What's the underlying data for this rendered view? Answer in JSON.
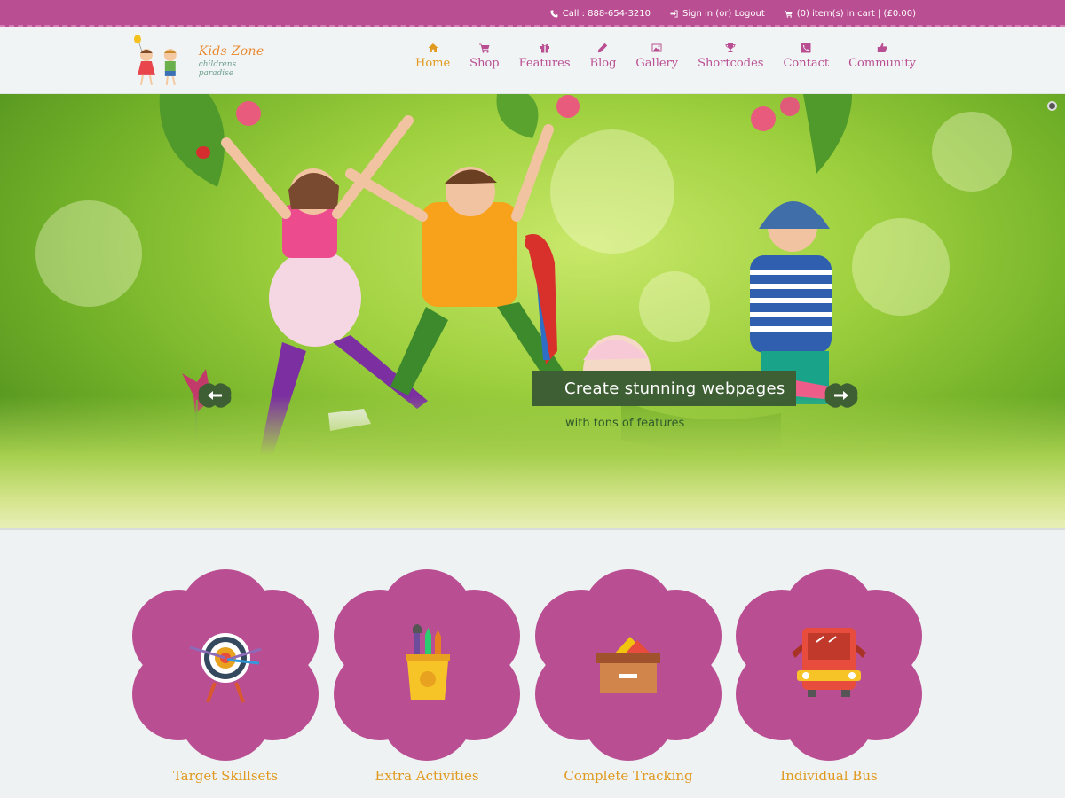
{
  "topbar": {
    "phone": "Call : 888-654-3210",
    "auth": "Sign in (or) Logout",
    "cart": "(0) item(s) in cart | (£0.00)"
  },
  "logo": {
    "title": "Kids Zone",
    "subtitle": "childrens paradise"
  },
  "nav": [
    {
      "label": "Home",
      "icon": "home-icon",
      "active": true
    },
    {
      "label": "Shop",
      "icon": "cart-icon"
    },
    {
      "label": "Features",
      "icon": "gift-icon"
    },
    {
      "label": "Blog",
      "icon": "pencil-icon"
    },
    {
      "label": "Gallery",
      "icon": "image-icon"
    },
    {
      "label": "Shortcodes",
      "icon": "trophy-icon"
    },
    {
      "label": "Contact",
      "icon": "phone-icon"
    },
    {
      "label": "Community",
      "icon": "thumbs-up-icon"
    }
  ],
  "hero": {
    "caption": "Create stunning webpages",
    "subcaption": "with tons of features"
  },
  "features": [
    {
      "label": "Target Skillsets",
      "icon": "target-icon"
    },
    {
      "label": "Extra Activities",
      "icon": "pencil-cup-icon"
    },
    {
      "label": "Complete Tracking",
      "icon": "file-drawer-icon"
    },
    {
      "label": "Individual Bus",
      "icon": "bus-icon"
    }
  ],
  "colors": {
    "brand": "#b94f92",
    "accent": "#e09a20",
    "caption_bg": "#3e5f33"
  }
}
